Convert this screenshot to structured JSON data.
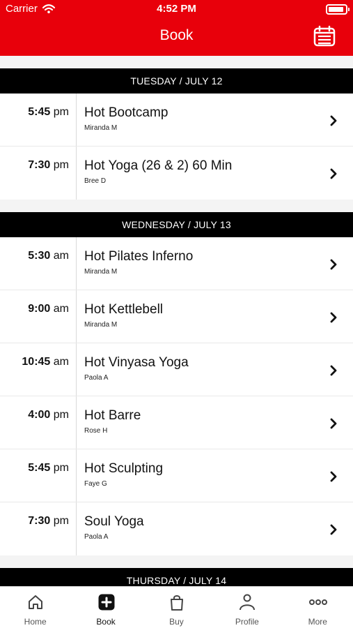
{
  "status_bar": {
    "carrier": "Carrier",
    "time": "4:52 PM"
  },
  "header": {
    "title": "Book",
    "calendar_icon": "calendar-icon"
  },
  "days": [
    {
      "label": "TUESDAY / JULY 12",
      "classes": [
        {
          "time": "5:45",
          "period": "pm",
          "name": "Hot Bootcamp",
          "instructor": "Miranda M"
        },
        {
          "time": "7:30",
          "period": "pm",
          "name": "Hot Yoga (26 & 2) 60 Min",
          "instructor": "Bree D"
        }
      ]
    },
    {
      "label": "WEDNESDAY / JULY 13",
      "classes": [
        {
          "time": "5:30",
          "period": "am",
          "name": "Hot Pilates Inferno",
          "instructor": "Miranda M"
        },
        {
          "time": "9:00",
          "period": "am",
          "name": "Hot Kettlebell",
          "instructor": "Miranda M"
        },
        {
          "time": "10:45",
          "period": "am",
          "name": "Hot Vinyasa Yoga",
          "instructor": "Paola A"
        },
        {
          "time": "4:00",
          "period": "pm",
          "name": "Hot Barre",
          "instructor": "Rose H"
        },
        {
          "time": "5:45",
          "period": "pm",
          "name": "Hot Sculpting",
          "instructor": "Faye G"
        },
        {
          "time": "7:30",
          "period": "pm",
          "name": "Soul Yoga",
          "instructor": "Paola A"
        }
      ]
    },
    {
      "label": "THURSDAY / JULY 14",
      "classes": []
    }
  ],
  "tabbar": {
    "home": "Home",
    "book": "Book",
    "buy": "Buy",
    "profile": "Profile",
    "more": "More"
  },
  "colors": {
    "brand_red": "#e8000b",
    "section_black": "#000000"
  }
}
